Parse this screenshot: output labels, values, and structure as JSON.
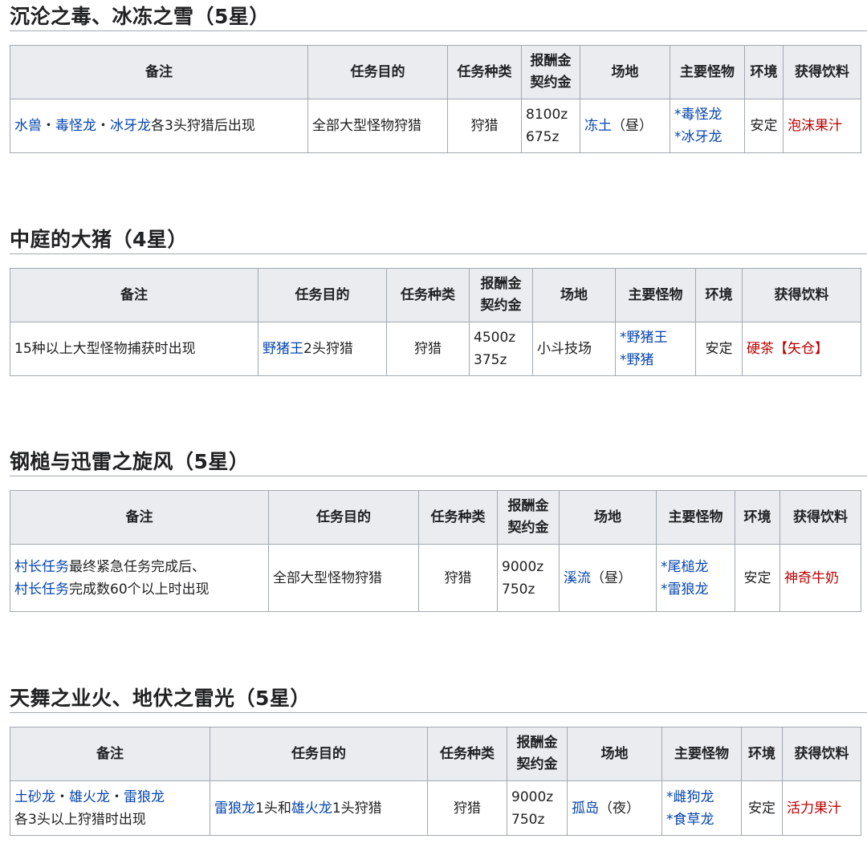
{
  "headers": {
    "note": "备注",
    "goal": "任务目的",
    "type": "任务种类",
    "reward": "报酬金",
    "contract": "契约金",
    "locale": "场地",
    "monsters": "主要怪物",
    "env": "环境",
    "drink": "获得饮料"
  },
  "quests": [
    {
      "title": "沉沦之毒、冰冻之雪（5星）",
      "note": {
        "part1": "水兽",
        "sep1": "・",
        "part2": "毒怪龙",
        "sep2": "・",
        "part3": "冰牙龙",
        "rest": "各3头狩猎后出现"
      },
      "goal": "全部大型怪物狩猎",
      "type": "狩猎",
      "reward": "8100z",
      "contract": "675z",
      "locale": {
        "name": "冻土",
        "time": "（昼）"
      },
      "monsters": [
        "*毒怪龙",
        "*冰牙龙"
      ],
      "env": "安定",
      "drink": "泡沫果汁"
    },
    {
      "title": "中庭的大猪（4星）",
      "note": {
        "text": "15种以上大型怪物捕获时出现"
      },
      "goal": {
        "link": "野猪王",
        "rest": "2头狩猎"
      },
      "type": "狩猎",
      "reward": "4500z",
      "contract": "375z",
      "locale": {
        "name": "小斗技场"
      },
      "monsters": [
        "*野猪王",
        "*野猪"
      ],
      "env": "安定",
      "drink": "硬茶【矢仓】"
    },
    {
      "title": "钢槌与迅雷之旋风（5星）",
      "note": {
        "link1": "村长任务",
        "rest1": "最终紧急任务完成后、",
        "link2": "村长任务",
        "rest2": "完成数60个以上时出现"
      },
      "goal": "全部大型怪物狩猎",
      "type": "狩猎",
      "reward": "9000z",
      "contract": "750z",
      "locale": {
        "name": "溪流",
        "time": "（昼）"
      },
      "monsters": [
        "*尾槌龙",
        "*雷狼龙"
      ],
      "env": "安定",
      "drink": "神奇牛奶"
    },
    {
      "title": "天舞之业火、地伏之雷光（5星）",
      "note": {
        "part1": "土砂龙",
        "sep1": "・",
        "part2": "雄火龙",
        "sep2": "・",
        "part3": "雷狼龙",
        "rest": "各3头以上狩猎时出现"
      },
      "goal": {
        "link1": "雷狼龙",
        "mid": "1头和",
        "link2": "雄火龙",
        "rest": "1头狩猎"
      },
      "type": "狩猎",
      "reward": "9000z",
      "contract": "750z",
      "locale": {
        "name": "孤岛",
        "time": "（夜）"
      },
      "monsters": [
        "*雌狗龙",
        "*食草龙"
      ],
      "env": "安定",
      "drink": "活力果汁"
    }
  ]
}
